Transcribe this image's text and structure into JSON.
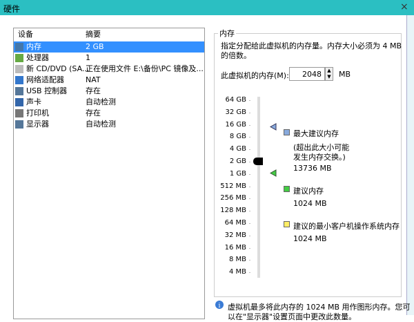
{
  "window": {
    "title": "硬件",
    "close": "×"
  },
  "list": {
    "headers": [
      "设备",
      "摘要"
    ],
    "rows": [
      {
        "name": "内存",
        "value": "2 GB",
        "icon": "memory-icon",
        "color": "#4477aa",
        "selected": true
      },
      {
        "name": "处理器",
        "value": "1",
        "icon": "cpu-icon",
        "color": "#66aa44"
      },
      {
        "name": "新 CD/DVD (SA...",
        "value": "正在使用文件 E:\\备份\\PC 镜像及...",
        "icon": "cd-icon",
        "color": "#bbbbbb"
      },
      {
        "name": "网络适配器",
        "value": "NAT",
        "icon": "network-icon",
        "color": "#3377cc"
      },
      {
        "name": "USB 控制器",
        "value": "存在",
        "icon": "usb-icon",
        "color": "#557799"
      },
      {
        "name": "声卡",
        "value": "自动检测",
        "icon": "sound-icon",
        "color": "#3366aa"
      },
      {
        "name": "打印机",
        "value": "存在",
        "icon": "printer-icon",
        "color": "#777777"
      },
      {
        "name": "显示器",
        "value": "自动检测",
        "icon": "monitor-icon",
        "color": "#557799"
      }
    ]
  },
  "memory": {
    "group_label": "内存",
    "desc1": "指定分配给此虚拟机的内存量。内存大小必须为 4 MB",
    "desc2": "的倍数。",
    "field_label": "此虚拟机的内存(M):",
    "value": "2048",
    "unit": "MB",
    "ticks": [
      "64 GB",
      "32 GB",
      "16 GB",
      "8 GB",
      "4 GB",
      "2 GB",
      "1 GB",
      "512 MB",
      "256 MB",
      "128 MB",
      "64 MB",
      "32 MB",
      "16 MB",
      "8 MB",
      "4 MB"
    ],
    "slider_value": "2 GB",
    "max_label": "最大建议内存",
    "max_note1": "(超出此大小可能",
    "max_note2": "发生内存交换。)",
    "max_value": "13736 MB",
    "max_color": "#88aadd",
    "rec_label": "建议内存",
    "rec_value": "1024 MB",
    "rec_color": "#44cc44",
    "min_label": "建议的最小客户机操作系统内存",
    "min_value": "1024 MB",
    "min_color": "#ffee66",
    "info1": "虚拟机最多将此内存的 1024 MB 用作图形内存。您可",
    "info2": "以在\"显示器\"设置页面中更改此数量。"
  }
}
